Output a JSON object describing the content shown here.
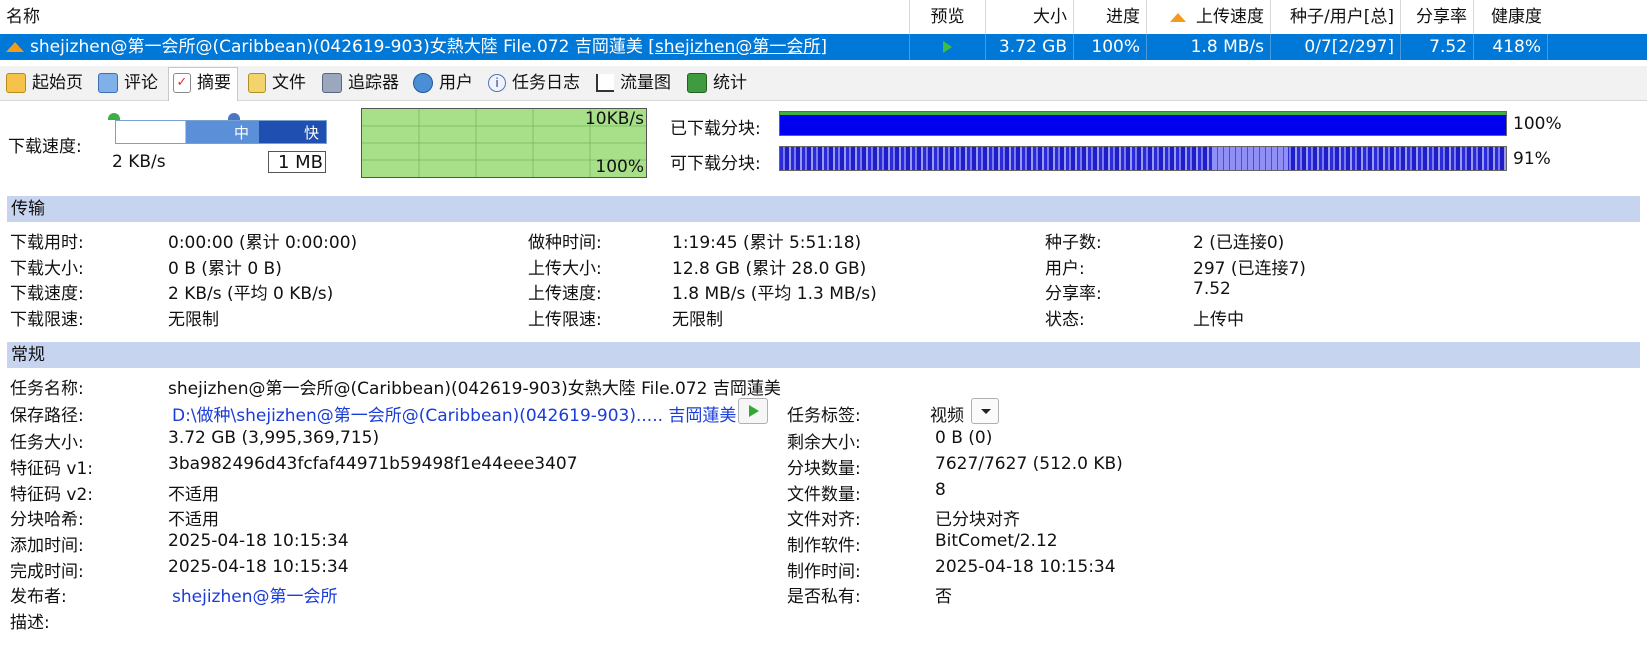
{
  "columns": {
    "name": "名称",
    "preview": "预览",
    "size": "大小",
    "progress": "进度",
    "upload_speed": "上传速度",
    "seeds_peers": "种子/用户[总]",
    "ratio": "分享率",
    "health": "健康度"
  },
  "task_row": {
    "name": "shejizhen@第一会所@(Caribbean)(042619-903)女熱大陸 File.072 吉岡蓮美",
    "name_tag": "[shejizhen@第一会所]",
    "size": "3.72 GB",
    "progress": "100%",
    "upload_speed": "1.8 MB/s",
    "seeds_peers": "0/7[2/297]",
    "ratio": "7.52",
    "health": "418%"
  },
  "tabs": [
    {
      "label": "起始页",
      "icon": "home-icon"
    },
    {
      "label": "评论",
      "icon": "comment-icon"
    },
    {
      "label": "摘要",
      "icon": "summary-icon"
    },
    {
      "label": "文件",
      "icon": "files-icon"
    },
    {
      "label": "追踪器",
      "icon": "tracker-icon"
    },
    {
      "label": "用户",
      "icon": "users-icon"
    },
    {
      "label": "任务日志",
      "icon": "log-icon"
    },
    {
      "label": "流量图",
      "icon": "traffic-chart-icon"
    },
    {
      "label": "统计",
      "icon": "stats-icon"
    }
  ],
  "speed_panel": {
    "label": "下载速度:",
    "slider_mid": "中",
    "slider_fast": "快",
    "current": "2 KB/s",
    "limit_box": "1 MB",
    "graph_top": "10KB/s",
    "graph_bottom": "100%"
  },
  "pieces": {
    "downloaded_label": "已下载分块:",
    "downloaded_pct": "100%",
    "available_label": "可下载分块:",
    "available_pct": "91%",
    "downloaded_fraction": 1.0,
    "available_fraction": 0.91
  },
  "transfer": {
    "title": "传输",
    "col1": [
      {
        "k": "下载用时:",
        "v": "0:00:00 (累计 0:00:00)"
      },
      {
        "k": "下载大小:",
        "v": "0 B (累计 0 B)"
      },
      {
        "k": "下载速度:",
        "v": "2 KB/s (平均 0 KB/s)"
      },
      {
        "k": "下载限速:",
        "v": "无限制"
      }
    ],
    "col2": [
      {
        "k": "做种时间:",
        "v": "1:19:45 (累计 5:51:18)"
      },
      {
        "k": "上传大小:",
        "v": "12.8 GB (累计 28.0 GB)"
      },
      {
        "k": "上传速度:",
        "v": "1.8 MB/s (平均 1.3 MB/s)"
      },
      {
        "k": "上传限速:",
        "v": "无限制"
      }
    ],
    "col3": [
      {
        "k": "种子数:",
        "v": "2 (已连接0)"
      },
      {
        "k": "用户:",
        "v": "297 (已连接7)"
      },
      {
        "k": "分享率:",
        "v": "7.52"
      },
      {
        "k": "状态:",
        "v": "上传中"
      }
    ]
  },
  "general": {
    "title": "常规",
    "task_name_k": "任务名称:",
    "task_name_v": "shejizhen@第一会所@(Caribbean)(042619-903)女熱大陸 File.072 吉岡蓮美",
    "save_path_k": "保存路径:",
    "save_path_v": "D:\\做种\\shejizhen@第一会所@(Caribbean)(042619-903)..... 吉岡蓮美",
    "tag_k": "任务标签:",
    "tag_v": "视频",
    "left": [
      {
        "k": "任务大小:",
        "v": "3.72 GB (3,995,369,715)"
      },
      {
        "k": "特征码 v1:",
        "v": "3ba982496d43fcfaf44971b59498f1e44eee3407"
      },
      {
        "k": "特征码 v2:",
        "v": "不适用"
      },
      {
        "k": "分块哈希:",
        "v": "不适用"
      },
      {
        "k": "添加时间:",
        "v": "2025-04-18 10:15:34"
      },
      {
        "k": "完成时间:",
        "v": "2025-04-18 10:15:34"
      }
    ],
    "right": [
      {
        "k": "剩余大小:",
        "v": "0 B (0)"
      },
      {
        "k": "分块数量:",
        "v": "7627/7627 (512.0 KB)"
      },
      {
        "k": "文件数量:",
        "v": "8"
      },
      {
        "k": "文件对齐:",
        "v": "已分块对齐"
      },
      {
        "k": "制作软件:",
        "v": "BitComet/2.12"
      },
      {
        "k": "制作时间:",
        "v": "2025-04-18 10:15:34"
      },
      {
        "k": "是否私有:",
        "v": "否"
      }
    ],
    "publisher_k": "发布者:",
    "publisher_v": "shejizhen@第一会所",
    "desc_k": "描述:"
  },
  "colors": {
    "selection": "#0078d7",
    "section_bar": "#c6d4ef",
    "piece_done": "#0000ee",
    "graph_bg": "#a8e08a",
    "link": "#1a3cd8"
  }
}
